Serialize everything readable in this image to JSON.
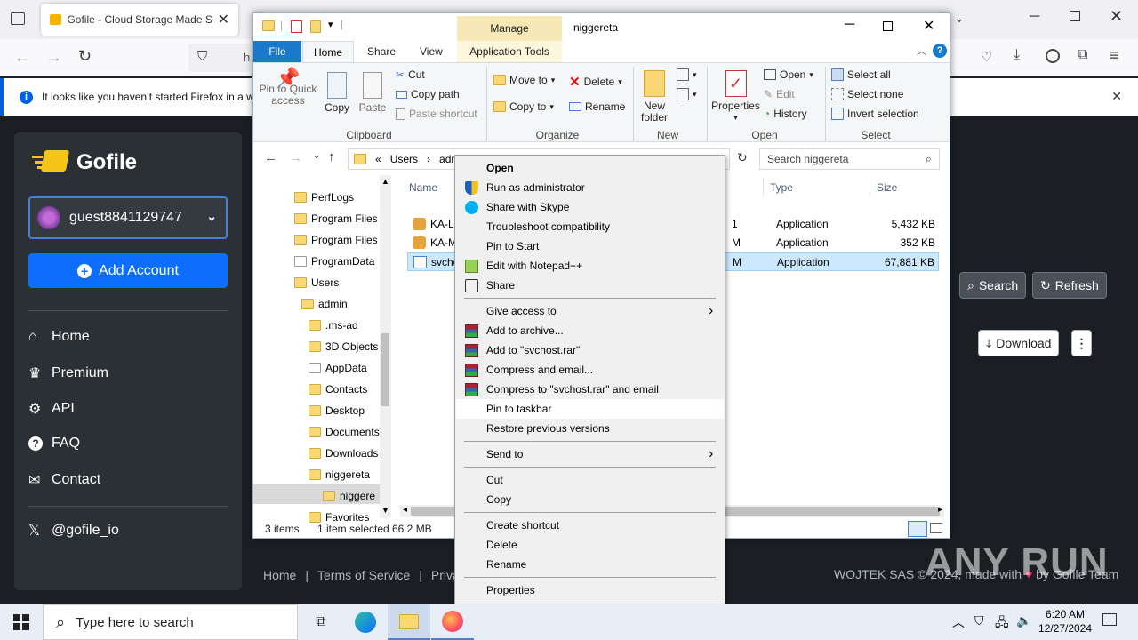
{
  "browser": {
    "tab_title": "Gofile - Cloud Storage Made Si",
    "url_partial": "h",
    "notice_text": "It looks like you haven’t started Firefox in a wh"
  },
  "gofile": {
    "brand": "Gofile",
    "account": "guest8841129747",
    "add_account": "Add Account",
    "nav": [
      {
        "label": "Home",
        "icon": "home-icon"
      },
      {
        "label": "Premium",
        "icon": "crown-icon"
      },
      {
        "label": "API",
        "icon": "cogs-icon"
      },
      {
        "label": "FAQ",
        "icon": "question-icon"
      },
      {
        "label": "Contact",
        "icon": "envelope-icon"
      }
    ],
    "social": "@gofile_io",
    "search_btn": "Search",
    "refresh_btn": "Refresh",
    "download_btn": "Download",
    "footer_links": [
      "Home",
      "Terms of Service",
      "Privacy"
    ],
    "footer_right": "WOJTEK SAS © 2024, made with",
    "footer_right_suffix": "by Gofile Team"
  },
  "explorer": {
    "window_title": "niggereta",
    "manage_tab": "Manage",
    "tabs": [
      "File",
      "Home",
      "Share",
      "View",
      "Application Tools"
    ],
    "ribbon": {
      "clipboard": {
        "pin": "Pin to Quick access",
        "copy": "Copy",
        "paste": "Paste",
        "cut": "Cut",
        "copy_path": "Copy path",
        "paste_shortcut": "Paste shortcut",
        "group": "Clipboard"
      },
      "organize": {
        "move_to": "Move to",
        "copy_to": "Copy to",
        "delete": "Delete",
        "rename": "Rename",
        "group": "Organize"
      },
      "new": {
        "new_folder": "New folder",
        "group": "New"
      },
      "open": {
        "properties": "Properties",
        "open": "Open",
        "edit": "Edit",
        "history": "History",
        "group": "Open"
      },
      "select": {
        "select_all": "Select all",
        "select_none": "Select none",
        "invert": "Invert selection",
        "group": "Select"
      }
    },
    "address": {
      "crumbs": [
        "«",
        "Users",
        "admi"
      ],
      "search_placeholder": "Search niggereta"
    },
    "nav_tree": [
      {
        "label": "PerfLogs",
        "indent": 0,
        "white": false
      },
      {
        "label": "Program Files",
        "indent": 0,
        "white": false
      },
      {
        "label": "Program Files",
        "indent": 0,
        "white": false
      },
      {
        "label": "ProgramData",
        "indent": 0,
        "white": true
      },
      {
        "label": "Users",
        "indent": 0,
        "white": false
      },
      {
        "label": "admin",
        "indent": 1,
        "white": false
      },
      {
        "label": ".ms-ad",
        "indent": 2,
        "white": false
      },
      {
        "label": "3D Objects",
        "indent": 2,
        "white": false
      },
      {
        "label": "AppData",
        "indent": 2,
        "white": true
      },
      {
        "label": "Contacts",
        "indent": 2,
        "white": false
      },
      {
        "label": "Desktop",
        "indent": 2,
        "white": false
      },
      {
        "label": "Documents",
        "indent": 2,
        "white": false
      },
      {
        "label": "Downloads",
        "indent": 2,
        "white": false
      },
      {
        "label": "niggereta",
        "indent": 3,
        "white": false
      },
      {
        "label": "niggere",
        "indent": 4,
        "white": false
      },
      {
        "label": "Favorites",
        "indent": 2,
        "white": false
      }
    ],
    "columns": {
      "name": "Name",
      "type": "Type",
      "size": "Size"
    },
    "files": [
      {
        "name": "KA-Li",
        "date_frag": "1",
        "type": "Application",
        "size": "5,432 KB",
        "selected": false
      },
      {
        "name": "KA-M",
        "date_frag": "M",
        "type": "Application",
        "size": "352 KB",
        "selected": false
      },
      {
        "name": "svcho",
        "date_frag": "M",
        "type": "Application",
        "size": "67,881 KB",
        "selected": true
      }
    ],
    "status": {
      "count": "3 items",
      "selection": "1 item selected",
      "size": "66.2 MB"
    }
  },
  "context_menu": {
    "items": [
      {
        "label": "Open",
        "bold": true,
        "icon": ""
      },
      {
        "label": "Run as administrator",
        "icon": "shield-icon"
      },
      {
        "label": "Share with Skype",
        "icon": "skype-icon"
      },
      {
        "label": "Troubleshoot compatibility",
        "icon": ""
      },
      {
        "label": "Pin to Start",
        "icon": ""
      },
      {
        "label": "Edit with Notepad++",
        "icon": "notepad-icon"
      },
      {
        "label": "Share",
        "icon": "share-icon"
      },
      {
        "sep": true
      },
      {
        "label": "Give access to",
        "submenu": true,
        "icon": ""
      },
      {
        "label": "Add to archive...",
        "icon": "winrar-icon"
      },
      {
        "label": "Add to \"svchost.rar\"",
        "icon": "winrar-icon"
      },
      {
        "label": "Compress and email...",
        "icon": "winrar-icon"
      },
      {
        "label": "Compress to \"svchost.rar\" and email",
        "icon": "winrar-icon"
      },
      {
        "label": "Pin to taskbar",
        "highlight": true,
        "icon": ""
      },
      {
        "label": "Restore previous versions",
        "icon": ""
      },
      {
        "sep": true
      },
      {
        "label": "Send to",
        "submenu": true,
        "icon": ""
      },
      {
        "sep": true
      },
      {
        "label": "Cut",
        "icon": ""
      },
      {
        "label": "Copy",
        "icon": ""
      },
      {
        "sep": true
      },
      {
        "label": "Create shortcut",
        "icon": ""
      },
      {
        "label": "Delete",
        "icon": ""
      },
      {
        "label": "Rename",
        "icon": ""
      },
      {
        "sep": true
      },
      {
        "label": "Properties",
        "icon": ""
      }
    ]
  },
  "taskbar": {
    "search_placeholder": "Type here to search",
    "time": "6:20 AM",
    "date": "12/27/2024"
  },
  "watermark": "ANY RUN"
}
